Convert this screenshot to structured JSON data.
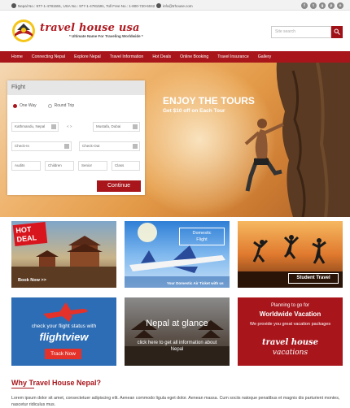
{
  "topbar": {
    "phone_text": "Nepal No.: 977-1-4781591, USA No.: 977-1-4781591, Toll Free No.: 1-800-720-6042",
    "email_text": "info@trhouse.com",
    "social_icons": [
      "facebook-icon",
      "twitter-icon",
      "googleplus-icon",
      "pinterest-icon",
      "instagram-icon"
    ],
    "social_glyphs": [
      "f",
      "t",
      "g",
      "p",
      "o"
    ]
  },
  "header": {
    "brand_name": "travel house usa",
    "tagline": "* Ultimate Name For Traveling Worldwide *",
    "search_placeholder": "Site search"
  },
  "nav": {
    "items": [
      "Home",
      "Connecting Nepal",
      "Explore Nepal",
      "Travel Information",
      "Hot Deals",
      "Online Booking",
      "Travel Insurance",
      "Gallery"
    ]
  },
  "hero": {
    "title": "ENJOY THE TOURS",
    "subtitle": "Get $10 off on Each Tour"
  },
  "booking": {
    "tab_label": "Flight",
    "trip_options": [
      "One Way",
      "Round Trip"
    ],
    "selected_trip": "One Way",
    "from_value": "Kathmandu, Nepal",
    "to_value": "Mustafa, Dubai",
    "swap_label": "< >",
    "checkin_placeholder": "Check-In",
    "checkout_placeholder": "Check-Out",
    "adults": "Audits",
    "children": "Children",
    "senior": "Senior",
    "class": "Class",
    "continue_label": "Continue"
  },
  "tiles": {
    "hot_deal_badge": "HOT\nDEAL",
    "hot_deal_link": "Book Now >>",
    "domestic_title": "Domestic\nFlight",
    "domestic_caption": "Your Domestic Air Ticket with us",
    "student_travel": "Student Travel",
    "flightview_line1": "check your flight status with",
    "flightview_brand": "flightview",
    "flightview_button": "Track Now",
    "glance_title": "Nepal at glance",
    "glance_text": "click here to get all information about Nepal",
    "glance_here": "here",
    "vacation_line1": "Planning to go for",
    "vacation_line2": "Worldwide Vacation",
    "vacation_line3": "We provide you great vacation packages",
    "vacation_brand1": "travel house",
    "vacation_brand2": "vacations"
  },
  "why": {
    "heading": "Why Travel House Nepal?",
    "body": "Lorem ipsum dolor sit amet, consectetuer adipiscing elit. Aenean commodo ligula eget dolor. Aenean massa. Cum sociis natoque penatibus et magnis dis parturient montes, nascetur ridiculus mus."
  },
  "colors": {
    "brand_red": "#a8161c",
    "accent_blue": "#2d6db5"
  }
}
